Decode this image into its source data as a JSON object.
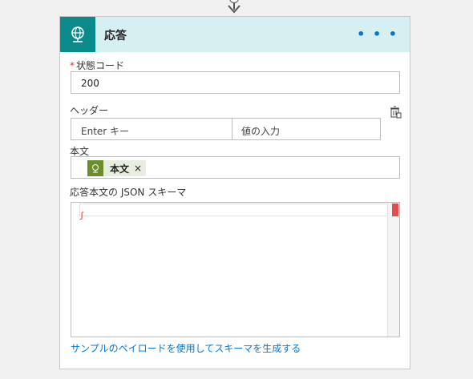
{
  "action": {
    "title": "応答",
    "menu_label": "…",
    "icon": "globe-network-icon"
  },
  "fields": {
    "status_code": {
      "required_mark": "*",
      "label": "状態コード",
      "value": "200"
    },
    "headers": {
      "label": "ヘッダー",
      "key_placeholder": "Enter キー",
      "value_placeholder": "値の入力"
    },
    "body": {
      "label": "本文",
      "token_label": "本文",
      "token_close": "×"
    },
    "schema": {
      "label": "応答本文の JSON スキーマ",
      "cursor_glyph": "ʃ"
    }
  },
  "generate_link": "サンプルのペイロードを使用してスキーマを生成する",
  "colors": {
    "header_bg": "#d6eff1",
    "icon_bg": "#0a8a8a",
    "accent": "#0078d4",
    "token_icon": "#6a8f2a",
    "token_bg": "#e8eedf",
    "required": "#d13438"
  }
}
